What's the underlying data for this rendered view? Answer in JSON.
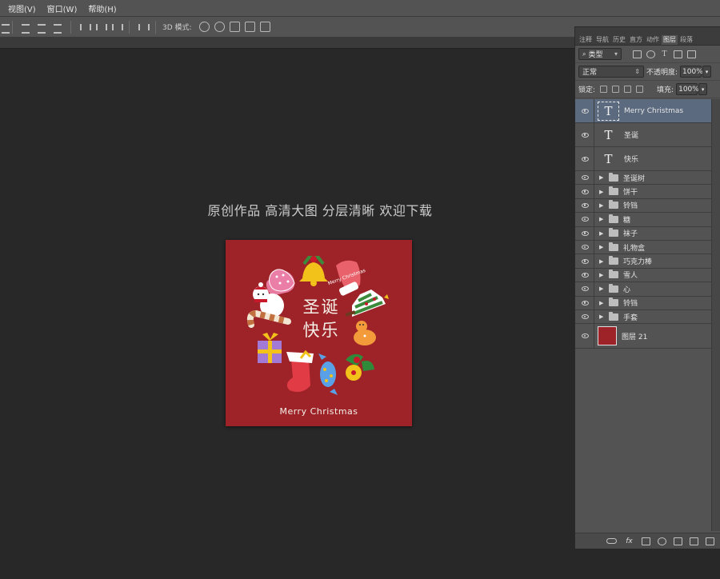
{
  "menu": [
    "视图(V)",
    "窗口(W)",
    "帮助(H)"
  ],
  "options_bar": {
    "mode_3d_label": "3D 模式:"
  },
  "canvas": {
    "heading": "原创作品  高清大图  分层清晰 欢迎下载",
    "document": {
      "title_line1": "圣诞",
      "title_line2": "快乐",
      "footer_text": "Merry Christmas",
      "mitten_text": "Merry Christmas",
      "background_color": "#9e2329"
    }
  },
  "layers_panel": {
    "tabs": [
      "注释",
      "导航",
      "历史",
      "直方",
      "动作",
      "图层",
      "段落"
    ],
    "active_tab": "图层",
    "filter_kind": "类型",
    "blend_mode": "正常",
    "opacity_label": "不透明度:",
    "opacity_value": "100%",
    "lock_label": "锁定:",
    "fill_label": "填充:",
    "fill_value": "100%",
    "text_layers": [
      {
        "name": "Merry Christmas",
        "thumb": "T",
        "selected": true
      },
      {
        "name": "圣诞",
        "thumb": "T",
        "selected": false
      },
      {
        "name": "快乐",
        "thumb": "T",
        "selected": false
      }
    ],
    "groups": [
      "圣诞树",
      "饼干",
      "铃铛",
      "糖",
      "袜子",
      "礼物盒",
      "巧克力棒",
      "雪人",
      "心",
      "铃铛",
      "手套"
    ],
    "bottom_layer": {
      "name": "图层 21",
      "thumb_color": "#9e2329"
    },
    "footer_icons": [
      "link-icon",
      "fx-icon",
      "mask-icon",
      "adjustment-icon",
      "new-group-icon",
      "new-layer-icon",
      "delete-icon"
    ]
  }
}
